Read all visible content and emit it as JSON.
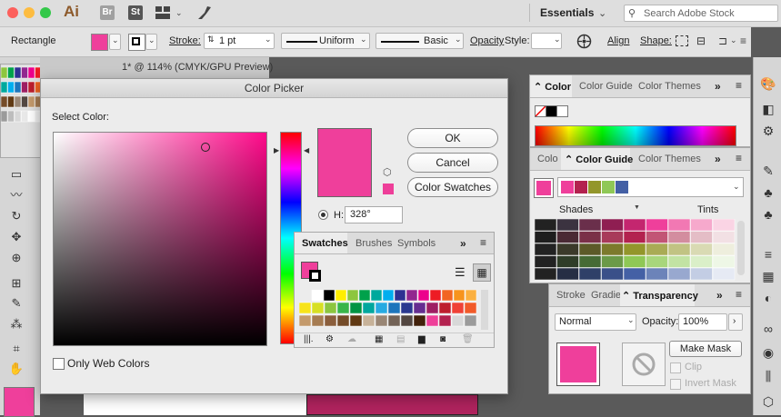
{
  "app": {
    "logo": "Ai",
    "bridge": "Br",
    "stock": "St",
    "workspace": "Essentials",
    "search_placeholder": "Search Adobe Stock"
  },
  "control_bar": {
    "tool_name": "Rectangle",
    "fill_color": "#ef3f9b",
    "stroke_label": "Stroke:",
    "stroke_weight": "1 pt",
    "profile_label": "Uniform",
    "brush_label": "Basic",
    "opacity_label": "Opacity",
    "style_label": "Style:",
    "align_label": "Align",
    "shape_label": "Shape:"
  },
  "document": {
    "tab_title": "1* @ 114% (CMYK/GPU Preview)"
  },
  "dialog": {
    "title": "Color Picker",
    "select_color_label": "Select Color:",
    "ok": "OK",
    "cancel": "Cancel",
    "color_swatches": "Color Swatches",
    "h_label": "H:",
    "h_value": "328°",
    "only_web_colors": "Only Web Colors",
    "current_color": "#ef3f9b",
    "web_safe_color": "#ee3f99"
  },
  "swatches_panel": {
    "tabs": [
      "Swatches",
      "Brushes",
      "Symbols"
    ],
    "selected_fill": "#ef3f9b"
  },
  "color_panel": {
    "tabs": [
      "Color",
      "Color Guide",
      "Color Themes"
    ]
  },
  "color_guide_panel": {
    "tabs": [
      "Colo",
      "Color Guide",
      "Color Themes"
    ],
    "harmony": [
      "#ef3f9b",
      "#b3224f",
      "#93962b",
      "#8fc856",
      "#4460a5"
    ],
    "shades_label": "Shades",
    "tints_label": "Tints"
  },
  "transparency_panel": {
    "tabs": [
      "Stroke",
      "Gradie",
      "Transparency"
    ],
    "blend_mode": "Normal",
    "opacity_label": "Opacity:",
    "opacity_value": "100%",
    "make_mask": "Make Mask",
    "clip": "Clip",
    "invert_mask": "Invert Mask"
  },
  "colors": {
    "accent": "#ef3f9b",
    "panel_bg": "#ececec"
  }
}
